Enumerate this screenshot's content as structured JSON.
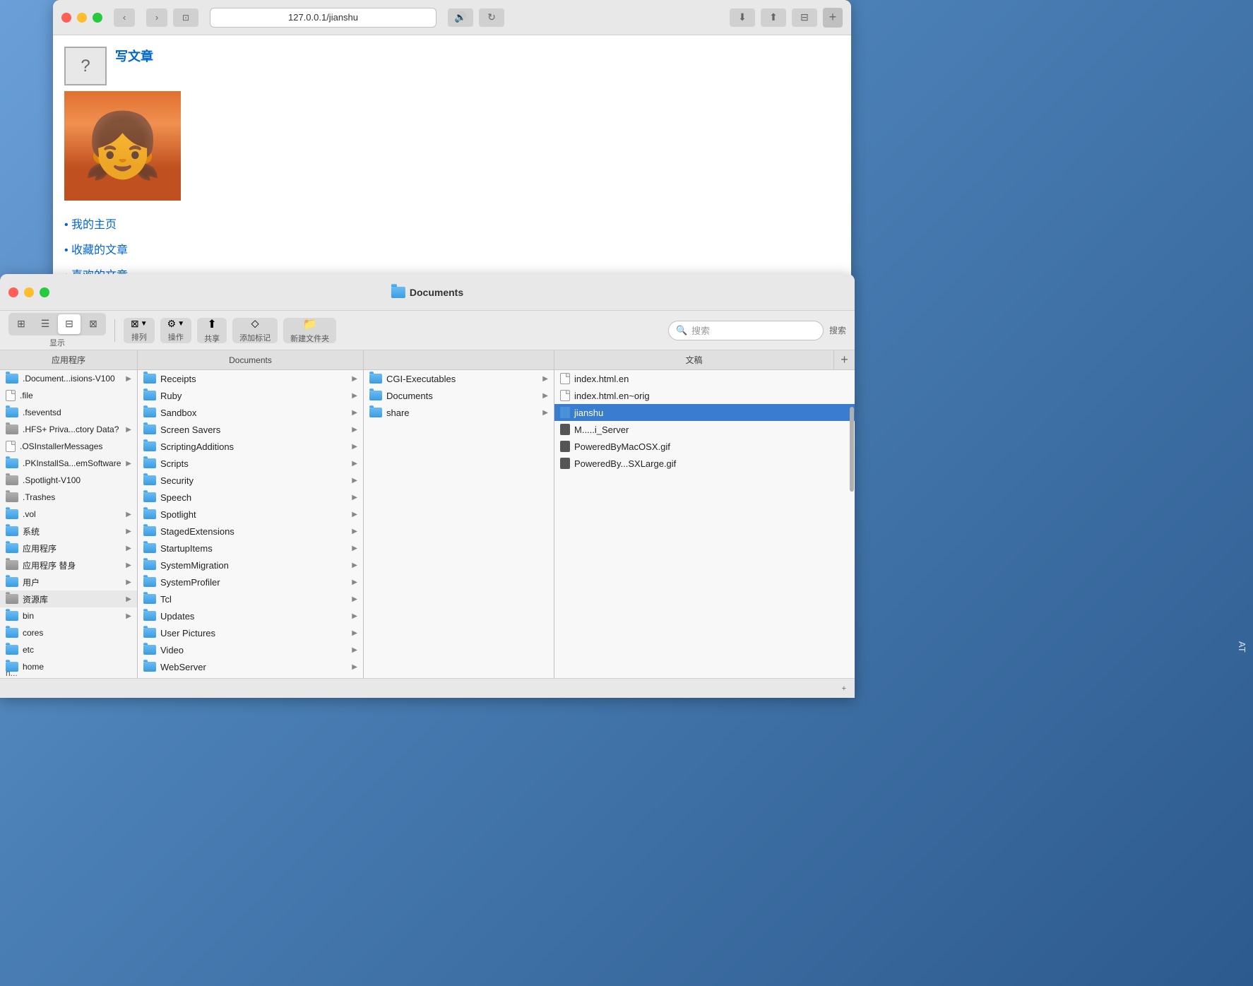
{
  "browser": {
    "address": "127.0.0.1/jianshu",
    "write_link": "写文章",
    "nav_links": [
      "我的主页",
      "收藏的文章",
      "喜欢的文章"
    ],
    "tl_close": "●",
    "tl_min": "●",
    "tl_max": "●",
    "nav_back": "‹",
    "nav_forward": "›",
    "tab_icon": "⊡",
    "sound_icon": "🔊",
    "reload_icon": "↻",
    "download_icon": "⬇",
    "share_icon": "⬆",
    "plus_icon": "+"
  },
  "finder": {
    "title": "Documents",
    "toolbar": {
      "view_labels": [
        "⊞",
        "☰",
        "⊟",
        "⊠"
      ],
      "sort_label": "排列",
      "action_label": "操作",
      "share_label": "共享",
      "tag_label": "添加标记",
      "newdir_label": "新建文件夹",
      "search_label": "搜索",
      "search_placeholder": "搜索",
      "display_label": "显示"
    },
    "col_headers": [
      "应用程序",
      "Documents",
      "文稿"
    ],
    "sidebar_items": [
      {
        "name": ".Document...isions-V100",
        "type": "folder-blue",
        "arrow": true
      },
      {
        "name": ".file",
        "type": "file",
        "arrow": false
      },
      {
        "name": ".fseventsd",
        "type": "folder-blue",
        "arrow": false
      },
      {
        "name": ".HFS+ Priva...ctory Data?",
        "type": "folder-blue",
        "arrow": true
      },
      {
        "name": ".OSInstallerMessages",
        "type": "file",
        "arrow": false
      },
      {
        "name": ".PKInstallSa...emSoftware",
        "type": "folder-blue",
        "arrow": true
      },
      {
        "name": ".Spotlight-V100",
        "type": "folder-blue",
        "arrow": false
      },
      {
        "name": ".Trashes",
        "type": "folder-blue",
        "arrow": false
      },
      {
        "name": ".vol",
        "type": "folder-blue",
        "arrow": true
      },
      {
        "name": "系统",
        "type": "folder-blue",
        "arrow": true
      },
      {
        "name": "应用程序",
        "type": "folder-blue",
        "arrow": true
      },
      {
        "name": "应用程序 替身",
        "type": "folder-blue",
        "arrow": true
      },
      {
        "name": "用户",
        "type": "folder-blue",
        "arrow": true
      },
      {
        "name": "资源库",
        "type": "folder-gray",
        "arrow": true
      },
      {
        "name": "bin",
        "type": "folder-blue",
        "arrow": true
      },
      {
        "name": "cores",
        "type": "folder-blue",
        "arrow": false
      },
      {
        "name": "etc",
        "type": "folder-blue",
        "arrow": false
      },
      {
        "name": "home",
        "type": "folder-blue",
        "arrow": false
      }
    ],
    "docs_items": [
      {
        "name": "Receipts",
        "type": "folder-blue",
        "arrow": true
      },
      {
        "name": "Ruby",
        "type": "folder-blue",
        "arrow": true
      },
      {
        "name": "Sandbox",
        "type": "folder-blue",
        "arrow": true
      },
      {
        "name": "Screen Savers",
        "type": "folder-blue",
        "arrow": true
      },
      {
        "name": "ScriptingAdditions",
        "type": "folder-blue",
        "arrow": true
      },
      {
        "name": "Scripts",
        "type": "folder-blue",
        "arrow": true
      },
      {
        "name": "Security",
        "type": "folder-blue",
        "arrow": true
      },
      {
        "name": "Speech",
        "type": "folder-blue",
        "arrow": true
      },
      {
        "name": "Spotlight",
        "type": "folder-blue",
        "arrow": true
      },
      {
        "name": "StagedExtensions",
        "type": "folder-blue",
        "arrow": true
      },
      {
        "name": "StartupItems",
        "type": "folder-blue",
        "arrow": true
      },
      {
        "name": "SystemMigration",
        "type": "folder-blue",
        "arrow": true
      },
      {
        "name": "SystemProfiler",
        "type": "folder-blue",
        "arrow": true
      },
      {
        "name": "Tcl",
        "type": "folder-blue",
        "arrow": true
      },
      {
        "name": "Updates",
        "type": "folder-blue",
        "arrow": true
      },
      {
        "name": "User Pictures",
        "type": "folder-blue",
        "arrow": true
      },
      {
        "name": "Video",
        "type": "folder-blue",
        "arrow": true
      },
      {
        "name": "WebServer",
        "type": "folder-blue",
        "arrow": true
      }
    ],
    "mid_items": [
      {
        "name": "CGI-Executables",
        "type": "folder-blue",
        "arrow": true
      },
      {
        "name": "Documents",
        "type": "folder-blue",
        "arrow": true,
        "selected": false
      },
      {
        "name": "share",
        "type": "folder-blue",
        "arrow": true
      }
    ],
    "right_items": [
      {
        "name": "index.html.en",
        "type": "file"
      },
      {
        "name": "index.html.en~orig",
        "type": "file"
      },
      {
        "name": "jianshu",
        "type": "file-blue",
        "selected": true
      },
      {
        "name": "M.....i_Server",
        "type": "file-dark"
      },
      {
        "name": "PoweredByMacOSX.gif",
        "type": "file-dark"
      },
      {
        "name": "PoweredBy...SXLarge.gif",
        "type": "file-dark"
      }
    ],
    "statusbar": {
      "add_icon": "+"
    }
  }
}
